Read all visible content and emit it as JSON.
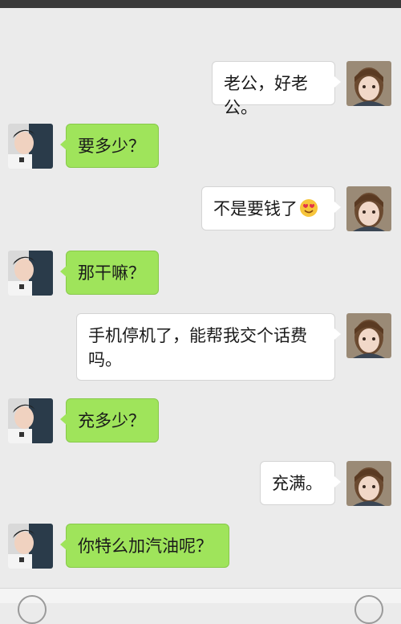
{
  "messages": [
    {
      "side": "right",
      "text": "老公，好老公。"
    },
    {
      "side": "left",
      "text": "要多少？"
    },
    {
      "side": "right",
      "text": "不是要钱了",
      "emoji": "heart-eyes-emoji"
    },
    {
      "side": "left",
      "text": "那干嘛？"
    },
    {
      "side": "right",
      "text": "手机停机了，能帮我交个话费吗。"
    },
    {
      "side": "left",
      "text": "充多少？"
    },
    {
      "side": "right",
      "text": "充满。"
    },
    {
      "side": "left",
      "text": "你特么加汽油呢？"
    }
  ],
  "colors": {
    "background": "#ebebeb",
    "sent_bubble": "#ffffff",
    "received_bubble": "#9fe45b"
  },
  "icons": {
    "sent_avatar": "girl-avatar",
    "received_avatar": "boy-avatar",
    "emoji": "heart-eyes-emoji",
    "voice": "voice-toggle-icon",
    "more": "more-options-icon"
  }
}
